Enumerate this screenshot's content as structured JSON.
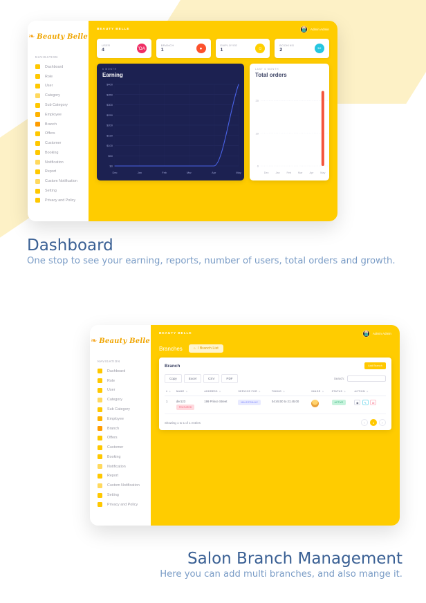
{
  "brand": {
    "mark": "❧",
    "name": "Beauty Belle"
  },
  "sidebar": {
    "nav_label": "NAVIGATION",
    "items": [
      {
        "label": "Dashboard",
        "icon": "home-icon",
        "color": "#ffc800"
      },
      {
        "label": "Role",
        "icon": "badge-icon",
        "color": "#ffc800"
      },
      {
        "label": "User",
        "icon": "user-icon",
        "color": "#ffc800"
      },
      {
        "label": "Category",
        "icon": "folder-icon",
        "color": "#ffd95e"
      },
      {
        "label": "Sub Category",
        "icon": "grid-icon",
        "color": "#ffc800"
      },
      {
        "label": "Employee",
        "icon": "employee-icon",
        "color": "#ffb300"
      },
      {
        "label": "Branch",
        "icon": "store-icon",
        "color": "#ff9d00"
      },
      {
        "label": "Offers",
        "icon": "tag-icon",
        "color": "#ffc800"
      },
      {
        "label": "Customer",
        "icon": "flag-icon",
        "color": "#ffc800"
      },
      {
        "label": "Booking",
        "icon": "scissors-icon",
        "color": "#ffc800"
      },
      {
        "label": "Notification",
        "icon": "bell-icon",
        "color": "#ffd95e"
      },
      {
        "label": "Report",
        "icon": "file-icon",
        "color": "#ffc800"
      },
      {
        "label": "Custom Notification",
        "icon": "gear-bell-icon",
        "color": "#ffd95e"
      },
      {
        "label": "Setting",
        "icon": "gear-icon",
        "color": "#ffc800"
      },
      {
        "label": "Privacy and Policy",
        "icon": "shield-icon",
        "color": "#ffc800"
      }
    ]
  },
  "topbar": {
    "title": "BEAUTY BELLE",
    "username": "Admin Admin"
  },
  "stats": [
    {
      "label": "USER",
      "value": "4",
      "icon": "chart-icon",
      "color": "#ef2d64"
    },
    {
      "label": "BRANCH",
      "value": "1",
      "icon": "shop-icon",
      "color": "#fc512d"
    },
    {
      "label": "EMPLOYEE",
      "value": "1",
      "icon": "people-icon",
      "color": "#ffd000"
    },
    {
      "label": "BOOKING",
      "value": "2",
      "icon": "scissors-icon",
      "color": "#26c6e0"
    }
  ],
  "chart_data": [
    {
      "type": "line",
      "title": "Earning",
      "subtitle": "6 MONTH",
      "categories": [
        "Dec",
        "Jan",
        "Feb",
        "Mar",
        "Apr",
        "May"
      ],
      "values": [
        0,
        0,
        0,
        0,
        0,
        400
      ],
      "ytick_labels": [
        "$400",
        "$350",
        "$300",
        "$250",
        "$200",
        "$150",
        "$100",
        "$50",
        "$0"
      ],
      "ylim": [
        0,
        400
      ],
      "line_color": "#4a63e8",
      "background": "#1c2151",
      "grid": true,
      "legend": "none",
      "xlabel": "",
      "ylabel": ""
    },
    {
      "type": "bar",
      "title": "Total orders",
      "subtitle": "LAST 6 MONTH",
      "categories": [
        "Dec",
        "Jan",
        "Feb",
        "Mar",
        "Apr",
        "May"
      ],
      "values": [
        0,
        0,
        0,
        0,
        0,
        23
      ],
      "ytick_labels": [
        "20",
        "10",
        "0"
      ],
      "ylim": [
        0,
        25
      ],
      "bar_color": "#f4543c",
      "background": "#ffffff",
      "grid": true,
      "legend": "none",
      "xlabel": "",
      "ylabel": ""
    }
  ],
  "captions": {
    "dashboard": {
      "title": "Dashboard",
      "subtitle": "One stop to see your earning, reports, number of users, total orders and growth."
    },
    "branch": {
      "title": "Salon Branch Management",
      "subtitle": "Here you can add multi branches, and also mange it."
    }
  },
  "branches_page": {
    "page_title": "Branches",
    "breadcrumb_home": "⌂",
    "breadcrumb_text": "/ Branch List",
    "panel_title": "Branch",
    "add_button": "Add Branch",
    "export_buttons": [
      "Copy",
      "Excel",
      "CSV",
      "PDF"
    ],
    "search_label": "Search:",
    "search_value": "",
    "search_placeholder": "",
    "columns": [
      "#",
      "NAME",
      "ADDRESS",
      "SERVICE FOR",
      "TIMING",
      "IMAGE",
      "STATUS",
      "ACTION"
    ],
    "rows": [
      {
        "index": "1",
        "name": "der123",
        "name_badge": "FEATURED",
        "address": "199 Prince Street",
        "service_for": "MALE/FEMALE",
        "timing": "04:45:00 to 21:45:00",
        "status": "ACTIVE",
        "actions": [
          "view",
          "edit",
          "delete"
        ]
      }
    ],
    "footer_info": "Showing 1 to 1 of 1 entries",
    "pager": {
      "prev": "‹",
      "pages": [
        "1"
      ],
      "next": "›"
    }
  }
}
